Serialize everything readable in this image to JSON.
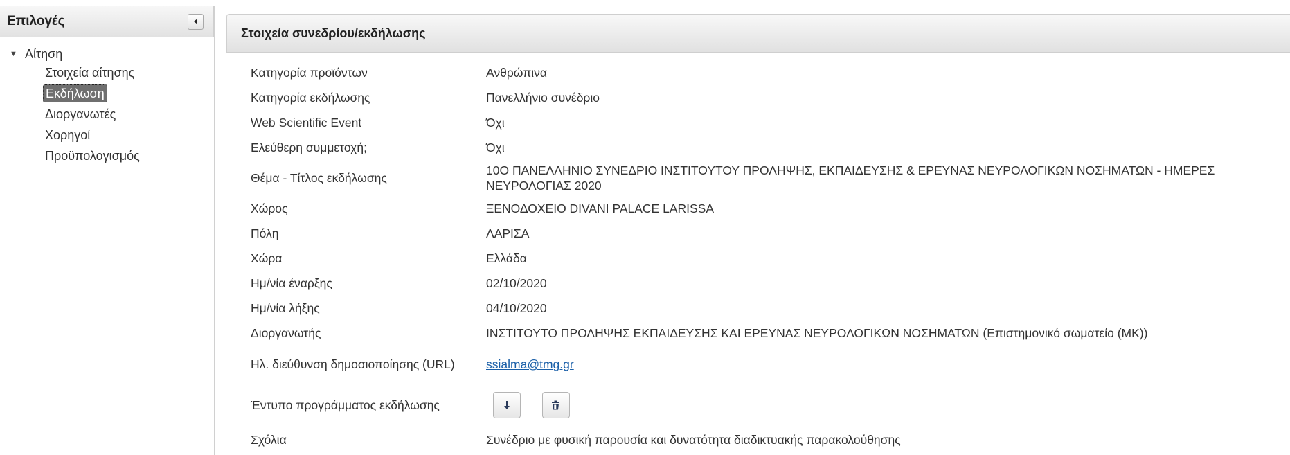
{
  "sidebar": {
    "title": "Επιλογές",
    "tree": {
      "root_label": "Αίτηση",
      "items": [
        {
          "label": "Στοιχεία αίτησης"
        },
        {
          "label": "Εκδήλωση"
        },
        {
          "label": "Διοργανωτές"
        },
        {
          "label": "Χορηγοί"
        },
        {
          "label": "Προϋπολογισμός"
        }
      ]
    }
  },
  "main": {
    "panel_title": "Στοιχεία συνεδρίου/εκδήλωσης",
    "fields": {
      "product_category": {
        "label": "Κατηγορία προϊόντων",
        "value": "Ανθρώπινα"
      },
      "event_category": {
        "label": "Κατηγορία εκδήλωσης",
        "value": "Πανελλήνιο συνέδριο"
      },
      "web_scientific_event": {
        "label": "Web Scientific Event",
        "value": "Όχι"
      },
      "free_participation": {
        "label": "Ελεύθερη συμμετοχή;",
        "value": "Όχι"
      },
      "event_title": {
        "label": "Θέμα - Τίτλος εκδήλωσης",
        "value": "10Ο ΠΑΝΕΛΛΗΝΙΟ ΣΥΝΕΔΡΙΟ ΙΝΣΤΙΤΟΥΤΟΥ ΠΡΟΛΗΨΗΣ, ΕΚΠΑΙΔΕΥΣΗΣ & ΕΡΕΥΝΑΣ ΝΕΥΡΟΛΟΓΙΚΩΝ ΝΟΣΗΜΑΤΩΝ - ΗΜΕΡΕΣ ΝΕΥΡΟΛΟΓΙΑΣ 2020"
      },
      "venue": {
        "label": "Χώρος",
        "value": "ΞΕΝΟΔΟΧΕΙΟ DIVANI PALACE LARISSA"
      },
      "city": {
        "label": "Πόλη",
        "value": "ΛΑΡΙΣΑ"
      },
      "country": {
        "label": "Χώρα",
        "value": "Ελλάδα"
      },
      "start_date": {
        "label": "Ημ/νία έναρξης",
        "value": "02/10/2020"
      },
      "end_date": {
        "label": "Ημ/νία λήξης",
        "value": "04/10/2020"
      },
      "organizer": {
        "label": "Διοργανωτής",
        "value": "ΙΝΣΤΙΤΟΥΤΟ ΠΡΟΛΗΨΗΣ ΕΚΠΑΙΔΕΥΣΗΣ ΚΑΙ ΕΡΕΥΝΑΣ ΝΕΥΡΟΛΟΓΙΚΩΝ ΝΟΣΗΜΑΤΩΝ (Επιστημονικό σωματείο (ΜΚ))"
      },
      "publication_url": {
        "label": "Ηλ. διεύθυνση δημοσιοποίησης (URL)",
        "value": "ssialma@tmg.gr"
      },
      "program_leaflet": {
        "label": "Έντυπο προγράμματος εκδήλωσης"
      },
      "comments": {
        "label": "Σχόλια",
        "value": "Συνέδριο με φυσική παρουσία και δυνατότητα διαδικτυακής παρακολούθησης"
      }
    }
  },
  "icons": {
    "collapse": "chevron-left-icon",
    "tree_toggle": "caret-down-icon",
    "download": "download-arrow-icon",
    "delete": "trash-icon"
  },
  "colors": {
    "link": "#1a5fa8",
    "active_item_bg": "#6f6f6f",
    "active_item_text": "#ffffff"
  }
}
